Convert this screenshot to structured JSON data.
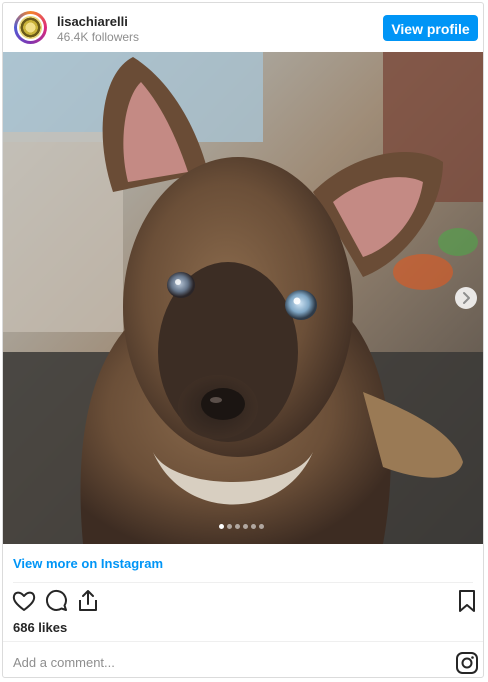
{
  "header": {
    "username": "lisachiarelli",
    "followers": "46.4K followers",
    "view_profile_label": "View profile"
  },
  "photo": {
    "subject": "puppy",
    "carousel_total": 6,
    "carousel_active": 1
  },
  "footer": {
    "view_more_label": "View more on Instagram",
    "likes": "686 likes",
    "comment_placeholder": "Add a comment..."
  },
  "icons": {
    "avatar": "avatar",
    "next": "chevron-right-icon",
    "like": "heart-icon",
    "comment": "comment-icon",
    "share": "share-icon",
    "save": "bookmark-icon",
    "instagram": "instagram-icon"
  },
  "colors": {
    "accent": "#0095f6",
    "text": "#262626",
    "muted": "#8e8e8e",
    "border": "#dbdbdb"
  }
}
